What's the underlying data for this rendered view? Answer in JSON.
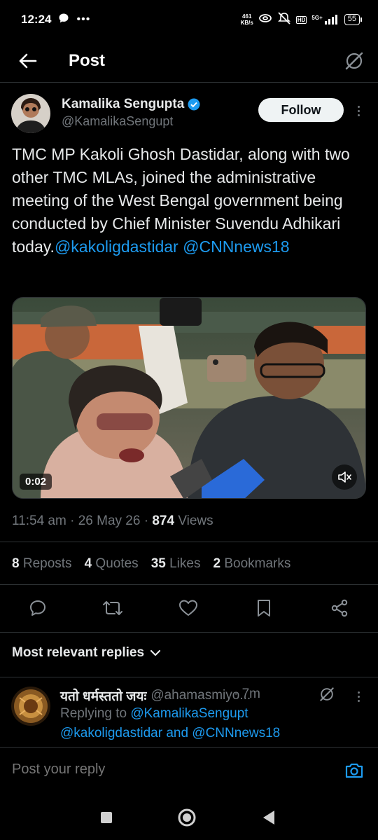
{
  "status": {
    "time": "12:24",
    "net_speed_value": "461",
    "net_speed_unit": "KB/s",
    "network_label": "5G+",
    "battery": "55"
  },
  "header": {
    "title": "Post"
  },
  "post": {
    "author_name": "Kamalika Sengupta",
    "author_handle": "@KamalikaSengupt",
    "follow_label": "Follow",
    "text": "TMC MP Kakoli Ghosh Dastidar, along with two other TMC MLAs, joined the administrative meeting of the West Bengal government being conducted by Chief Minister Suvendu Adhikari today.",
    "mention_1": "@kakoligdastidar",
    "mention_2": "@CNNnews18",
    "video_duration": "0:02",
    "time": "11:54 am",
    "date": "26 May 26",
    "views_count": "874",
    "views_label": "Views"
  },
  "stats": {
    "reposts_count": "8",
    "reposts_label": "Reposts",
    "quotes_count": "4",
    "quotes_label": "Quotes",
    "likes_count": "35",
    "likes_label": "Likes",
    "bookmarks_count": "2",
    "bookmarks_label": "Bookmarks"
  },
  "replies": {
    "sort_label": "Most relevant replies",
    "items": [
      {
        "name": "यतो धर्मस्ततो जयः",
        "handle": "@ahamasmiyo...",
        "time": "· 7m",
        "replying_prefix": "Replying to",
        "replying_1": "@KamalikaSengupt",
        "replying_2": "@kakoligdastidar",
        "replying_and": "and",
        "replying_3": "@CNNnews18"
      }
    ]
  },
  "compose": {
    "placeholder": "Post your reply"
  },
  "colors": {
    "accent": "#1d9bf0",
    "background": "#000000",
    "muted": "#71767b",
    "text": "#e7e9ea"
  }
}
